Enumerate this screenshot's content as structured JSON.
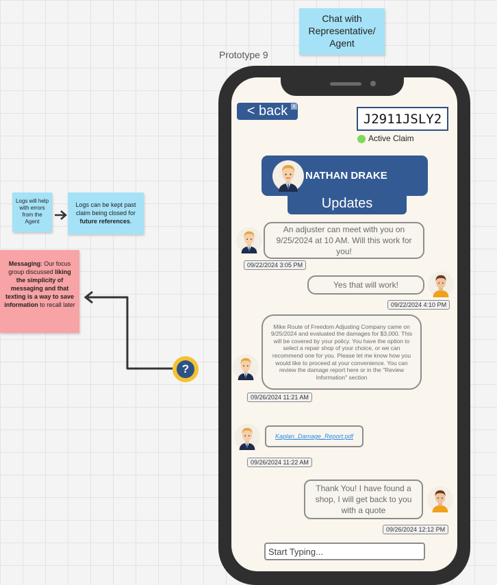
{
  "canvas": {
    "title_note": "Chat with Representative/ Agent",
    "prototype_label": "Prototype 9",
    "notes": {
      "logs_help": "Logs will help with errors from the Agent",
      "logs_kept_pre": "Logs can be kept past claim being closed for ",
      "logs_kept_bold": "future references",
      "logs_kept_post": ".",
      "messaging_label": "Messaging",
      "messaging_text1": ": Our focus group discussed ",
      "messaging_bold1": "liking the simplicity of messaging and that texting is a way to save information",
      "messaging_text2": " to recall later"
    },
    "help_icon": "question-mark-icon"
  },
  "phone": {
    "back_label": "< back",
    "back_close": "x",
    "claim_id": "J2911JSLY2",
    "claim_status": "Active Claim",
    "agent_name": "NATHAN DRAKE",
    "updates_label": "Updates",
    "messages": [
      {
        "sender": "agent",
        "text": "An adjuster can meet with you on 9/25/2024 at 10 AM. Will this work for you!",
        "time": "09/22/2024  3:05 PM"
      },
      {
        "sender": "user",
        "text": "Yes that will work!",
        "time": "09/22/2024  4:10 PM"
      },
      {
        "sender": "agent",
        "text": "Mike Route of Freedom Adjusting Company came on 9/25/2024 and evaluated the damages for $3,000. This will be covered by your policy. You have the option to select a repair shop of your choice, or we can recommend one for you. Please let me know how you would like to proceed at your convenience. You can review the damage report here or in the \"Review Information\" section",
        "time": "09/26/2024  11:21 AM"
      },
      {
        "sender": "agent",
        "attachment": "Kaplan_Damage_Report.pdf",
        "time": "09/26/2024  11:22 AM"
      },
      {
        "sender": "user",
        "text": "Thank You! I have found a shop, I will get back to you with a quote",
        "time": "09/26/2024  12:12 PM"
      }
    ],
    "input_placeholder": "Start Typing...",
    "colors": {
      "primary": "#345a94",
      "status_green": "#7ed957",
      "sticky_blue": "#a5e2f7",
      "sticky_red": "#f8a3a5"
    }
  }
}
